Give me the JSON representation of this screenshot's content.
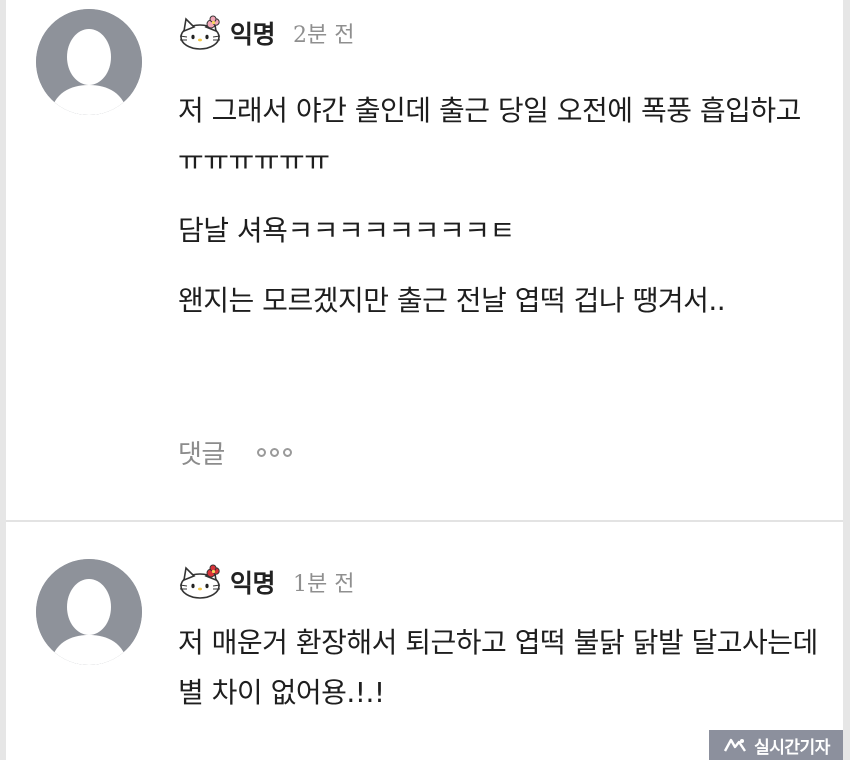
{
  "comments": [
    {
      "author": "익명",
      "time": "2분 전",
      "paragraphs": [
        "저 그래서 야간 출인데 출근 당일 오전에 폭풍 흡입하고 ㅠㅠㅠㅠㅠㅠ",
        "담날 셔욕ㅋㅋㅋㅋㅋㅋㅋㅋㅌ",
        "왠지는 모르겠지만 출근 전날 엽떡 겁나 땡겨서.."
      ],
      "reply_label": "댓글"
    },
    {
      "author": "익명",
      "time": "1분 전",
      "paragraphs": [
        "저 매운거 환장해서 퇴근하고 엽떡 불닭 닭발 달고사는데 별 차이 없어용.!.!"
      ]
    }
  ],
  "watermark": {
    "text": "실시간기자"
  },
  "colors": {
    "avatar": "#8e929a",
    "meta_gray": "#8f8f8f",
    "divider": "#e3e3e3"
  },
  "icons": {
    "avatar": "default-user-silhouette",
    "badge": "hello-kitty"
  }
}
